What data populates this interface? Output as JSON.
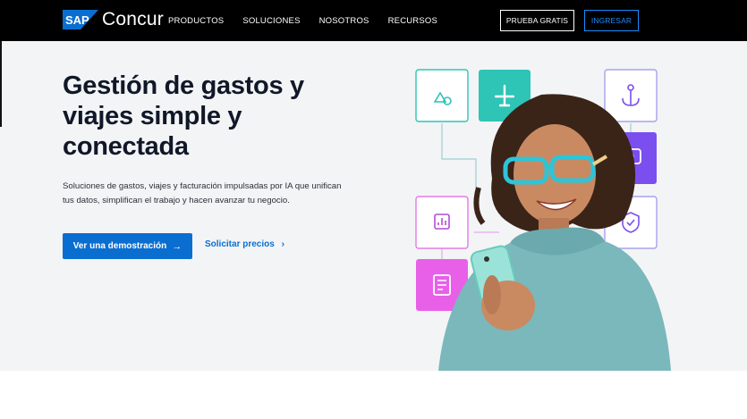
{
  "brand": {
    "sap": "SAP",
    "name": "Concur",
    "sap_color": "#0a6ed1"
  },
  "nav": {
    "items": [
      {
        "label": "PRODUCTOS"
      },
      {
        "label": "SOLUCIONES"
      },
      {
        "label": "NOSOTROS"
      },
      {
        "label": "RECURSOS"
      }
    ],
    "trial_button": "PRUEBA GRATIS",
    "login_button": "INGRESAR"
  },
  "hero": {
    "headline_lines": [
      "Gestión de gastos y",
      "viajes simple y",
      "conectada"
    ],
    "subtext_lines": [
      "Soluciones de gastos, viajes y facturación impulsadas por IA que unifican",
      "tus datos, simplifican el trabajo y hacen avanzar tu negocio."
    ],
    "demo_button": "Ver una demostración",
    "demo_arrow": "→",
    "price_link": "Solicitar precios",
    "price_chevron": "›"
  },
  "illustration": {
    "tiles": [
      {
        "icon": "shapes-icon",
        "style": "outline-teal"
      },
      {
        "icon": "airplane-icon",
        "style": "filled-teal"
      },
      {
        "icon": "anchor-icon",
        "style": "outline-lavender"
      },
      {
        "icon": "money-icon",
        "style": "filled-purple"
      },
      {
        "icon": "chart-icon",
        "style": "outline-pink"
      },
      {
        "icon": "shield-check-icon",
        "style": "outline-lavender"
      },
      {
        "icon": "receipt-icon",
        "style": "filled-pink"
      }
    ],
    "colors": {
      "teal": "#2ec4b6",
      "purple": "#7b4ef0",
      "pink": "#e860e8",
      "lavender": "#a9a0ee"
    }
  }
}
